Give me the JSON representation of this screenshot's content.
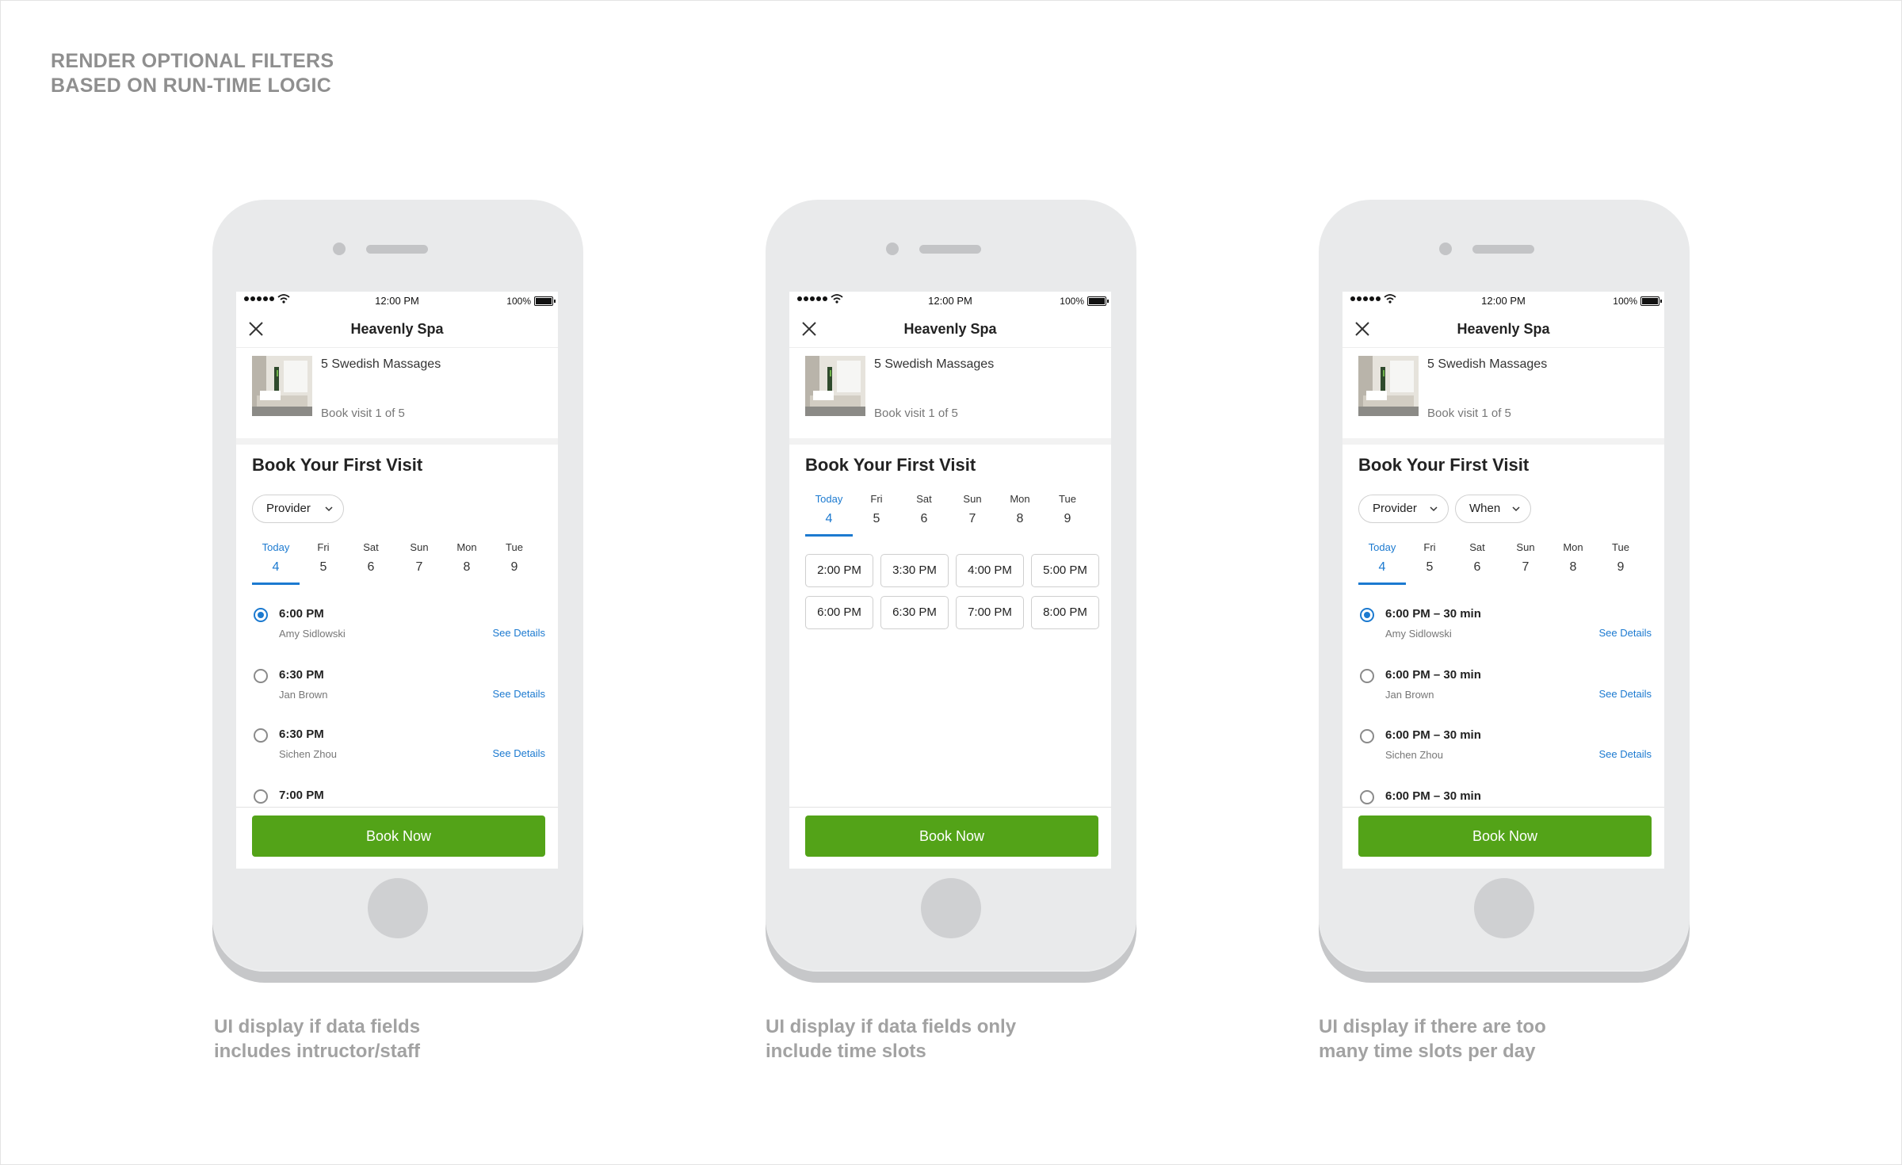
{
  "page": {
    "title_line1": "RENDER OPTIONAL FILTERS",
    "title_line2": "BASED ON RUN-TIME LOGIC",
    "accent_blue": "#1c7ad0",
    "brand_green": "#53a318"
  },
  "phones": [
    {
      "caption_line1": "UI display if data fields",
      "caption_line2": "includes intructor/staff",
      "status": {
        "time": "12:00 PM",
        "battery": "100%"
      },
      "nav_title": "Heavenly Spa",
      "deal_name": "5 Swedish Massages",
      "deal_sub": "Book visit 1 of 5",
      "heading": "Book Your First Visit",
      "filters": [
        "Provider"
      ],
      "dates": [
        {
          "dow": "Today",
          "num": "4",
          "active": true
        },
        {
          "dow": "Fri",
          "num": "5"
        },
        {
          "dow": "Sat",
          "num": "6"
        },
        {
          "dow": "Sun",
          "num": "7"
        },
        {
          "dow": "Mon",
          "num": "8"
        },
        {
          "dow": "Tue",
          "num": "9"
        }
      ],
      "slots": [
        {
          "time": "6:00 PM",
          "provider": "Amy Sidlowski",
          "details": "See Details",
          "selected": true
        },
        {
          "time": "6:30 PM",
          "provider": "Jan Brown",
          "details": "See Details"
        },
        {
          "time": "6:30 PM",
          "provider": "Sichen Zhou",
          "details": "See Details"
        },
        {
          "time": "7:00 PM"
        }
      ],
      "cta": "Book Now"
    },
    {
      "caption_line1": "UI display if data fields only",
      "caption_line2": "include time slots",
      "status": {
        "time": "12:00 PM",
        "battery": "100%"
      },
      "nav_title": "Heavenly Spa",
      "deal_name": "5 Swedish Massages",
      "deal_sub": "Book visit 1 of 5",
      "heading": "Book Your First Visit",
      "dates": [
        {
          "dow": "Today",
          "num": "4",
          "active": true
        },
        {
          "dow": "Fri",
          "num": "5"
        },
        {
          "dow": "Sat",
          "num": "6"
        },
        {
          "dow": "Sun",
          "num": "7"
        },
        {
          "dow": "Mon",
          "num": "8"
        },
        {
          "dow": "Tue",
          "num": "9"
        }
      ],
      "time_buttons": [
        "2:00 PM",
        "3:30 PM",
        "4:00 PM",
        "5:00 PM",
        "6:00 PM",
        "6:30 PM",
        "7:00 PM",
        "8:00 PM"
      ],
      "cta": "Book Now"
    },
    {
      "caption_line1": "UI display if there are too",
      "caption_line2": "many time slots per day",
      "status": {
        "time": "12:00 PM",
        "battery": "100%"
      },
      "nav_title": "Heavenly Spa",
      "deal_name": "5 Swedish Massages",
      "deal_sub": "Book visit 1 of 5",
      "heading": "Book Your First Visit",
      "filters": [
        "Provider",
        "When"
      ],
      "dates": [
        {
          "dow": "Today",
          "num": "4",
          "active": true
        },
        {
          "dow": "Fri",
          "num": "5"
        },
        {
          "dow": "Sat",
          "num": "6"
        },
        {
          "dow": "Sun",
          "num": "7"
        },
        {
          "dow": "Mon",
          "num": "8"
        },
        {
          "dow": "Tue",
          "num": "9"
        }
      ],
      "slots": [
        {
          "time": "6:00 PM – 30 min",
          "provider": "Amy Sidlowski",
          "details": "See Details",
          "selected": true
        },
        {
          "time": "6:00 PM – 30 min",
          "provider": "Jan Brown",
          "details": "See Details"
        },
        {
          "time": "6:00 PM – 30 min",
          "provider": "Sichen Zhou",
          "details": "See Details"
        },
        {
          "time": "6:00 PM – 30 min"
        }
      ],
      "cta": "Book Now"
    }
  ]
}
